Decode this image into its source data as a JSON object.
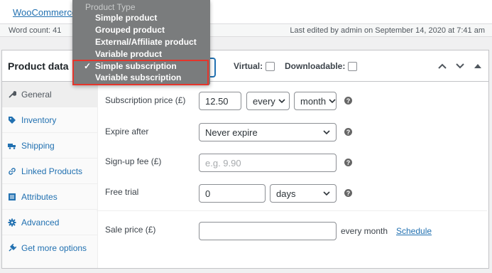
{
  "top": {
    "link": "WooCommerce"
  },
  "status": {
    "word_count": "Word count: 41",
    "last_edited": "Last edited by admin on September 14, 2020 at 7:41 am"
  },
  "panel": {
    "title": "Product data",
    "virtual_label": "Virtual:",
    "downloadable_label": "Downloadable:"
  },
  "tabs": [
    {
      "label": "General",
      "icon": "wrench-icon"
    },
    {
      "label": "Inventory",
      "icon": "tag-icon"
    },
    {
      "label": "Shipping",
      "icon": "truck-icon"
    },
    {
      "label": "Linked Products",
      "icon": "link-icon"
    },
    {
      "label": "Attributes",
      "icon": "list-icon"
    },
    {
      "label": "Advanced",
      "icon": "gear-icon"
    },
    {
      "label": "Get more options",
      "icon": "plugin-icon"
    }
  ],
  "fields": {
    "subscription_price": {
      "label": "Subscription price (£)",
      "value": "12.50",
      "interval": "every",
      "period": "month"
    },
    "expire_after": {
      "label": "Expire after",
      "value": "Never expire"
    },
    "signup_fee": {
      "label": "Sign-up fee (£)",
      "placeholder": "e.g. 9.90"
    },
    "free_trial": {
      "label": "Free trial",
      "value": "0",
      "unit": "days"
    },
    "sale_price": {
      "label": "Sale price (£)",
      "suffix": "every month",
      "schedule": "Schedule"
    }
  },
  "dropdown": {
    "group_label": "Product Type",
    "options": [
      {
        "label": "Simple product"
      },
      {
        "label": "Grouped product"
      },
      {
        "label": "External/Affiliate product"
      },
      {
        "label": "Variable product"
      },
      {
        "label": "Simple subscription",
        "check": "✓"
      },
      {
        "label": "Variable subscription"
      }
    ]
  },
  "colors": {
    "accent": "#2271b1",
    "highlight": "#e5352b",
    "dropdown_bg": "#7a7c7d"
  }
}
